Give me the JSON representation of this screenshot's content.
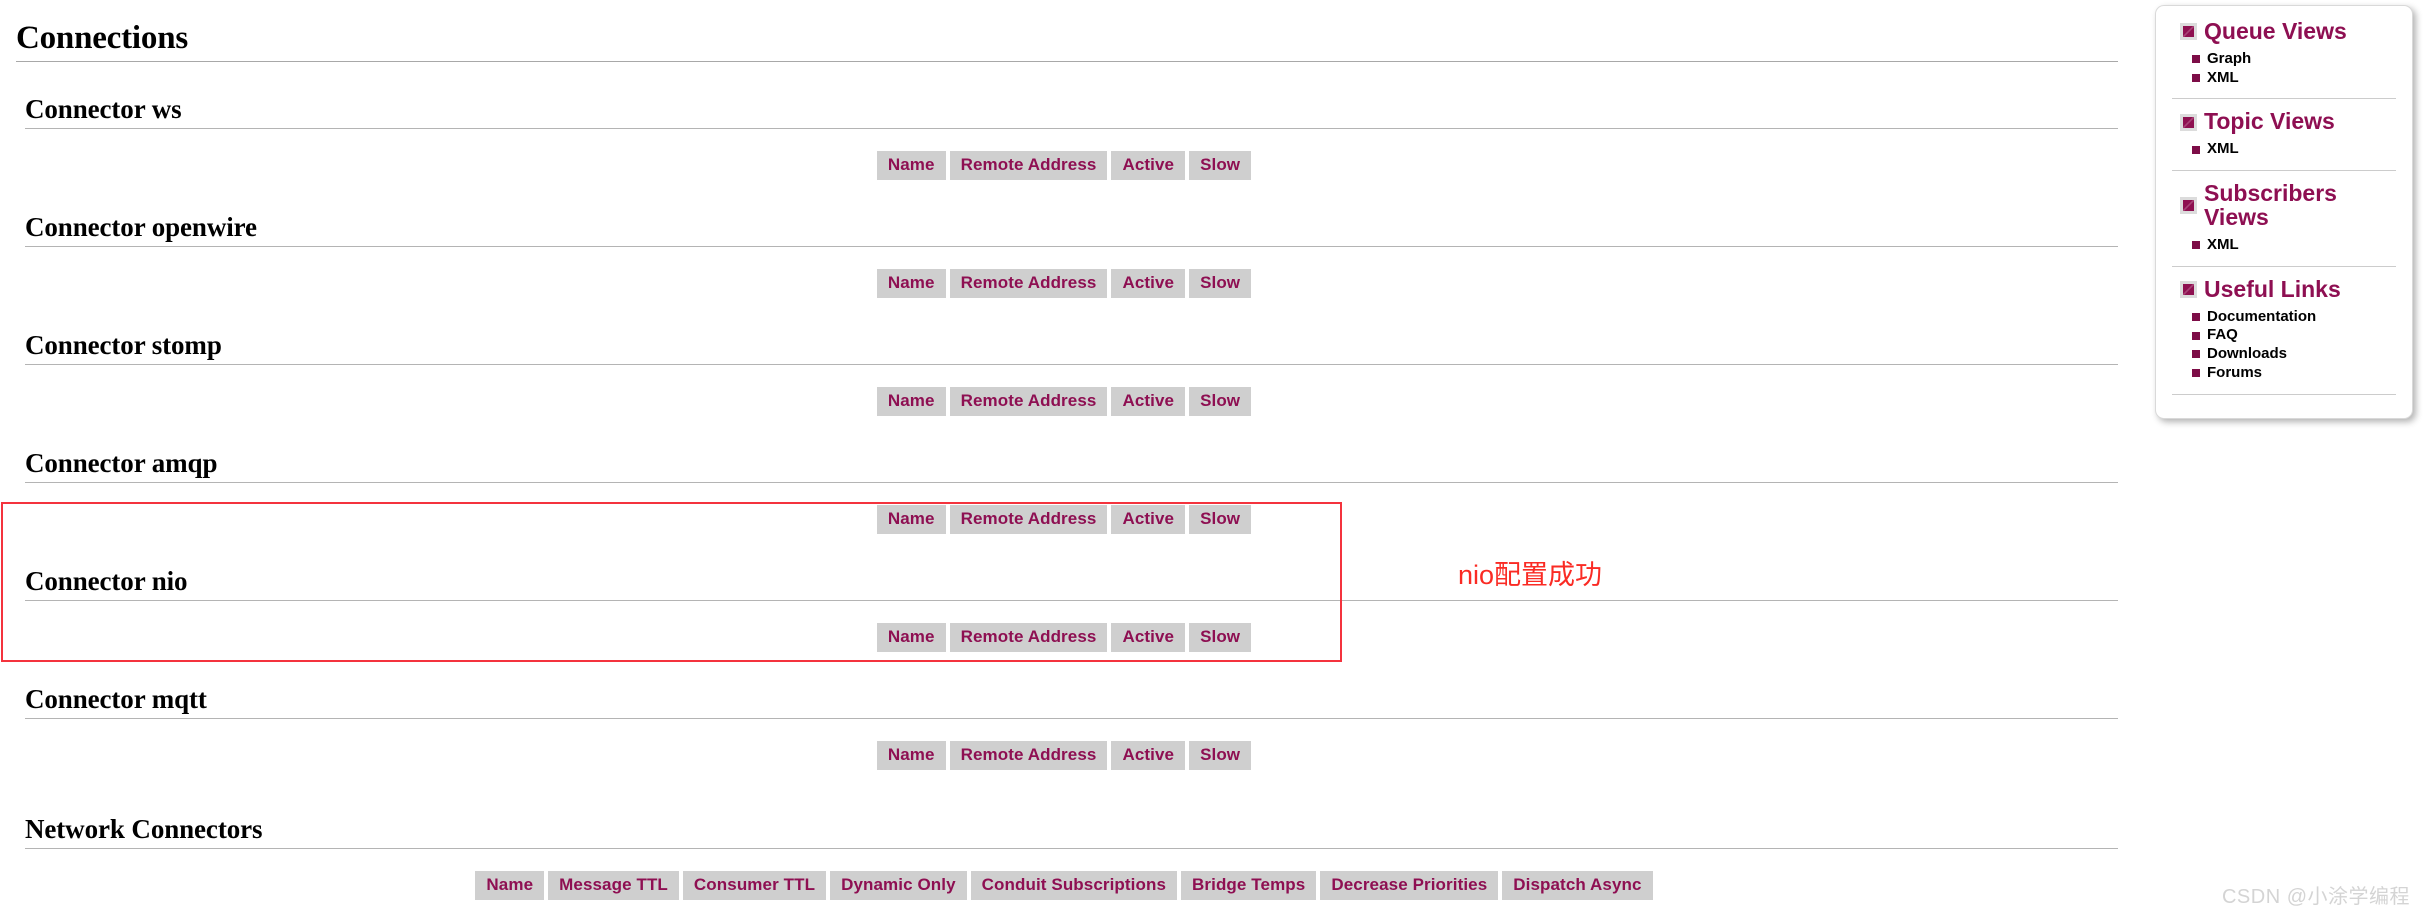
{
  "main": {
    "page_title": "Connections",
    "connection_table_headers": [
      "Name",
      "Remote Address",
      "Active",
      "Slow"
    ],
    "connectors": [
      {
        "title": "Connector ws"
      },
      {
        "title": "Connector openwire"
      },
      {
        "title": "Connector stomp"
      },
      {
        "title": "Connector amqp"
      },
      {
        "title": "Connector nio"
      },
      {
        "title": "Connector mqtt"
      }
    ],
    "network_connectors": {
      "title": "Network Connectors",
      "headers": [
        "Name",
        "Message TTL",
        "Consumer TTL",
        "Dynamic Only",
        "Conduit Subscriptions",
        "Bridge Temps",
        "Decrease Priorities",
        "Dispatch Async"
      ]
    }
  },
  "annotation": {
    "text": "nio配置成功",
    "color": "#fa2b24"
  },
  "sidebar": {
    "sections": [
      {
        "title": "Queue Views",
        "items": [
          "Graph",
          "XML"
        ]
      },
      {
        "title": "Topic Views",
        "items": [
          "XML"
        ]
      },
      {
        "title": "Subscribers Views",
        "items": [
          "XML"
        ]
      },
      {
        "title": "Useful Links",
        "items": [
          "Documentation",
          "FAQ",
          "Downloads",
          "Forums"
        ]
      }
    ]
  },
  "watermark": {
    "text": "CSDN @小涂学编程"
  },
  "colors": {
    "accent_maroon": "#8e0f52",
    "header_cell_bg": "#cfcfcf",
    "annotation_red": "#f4333d"
  }
}
